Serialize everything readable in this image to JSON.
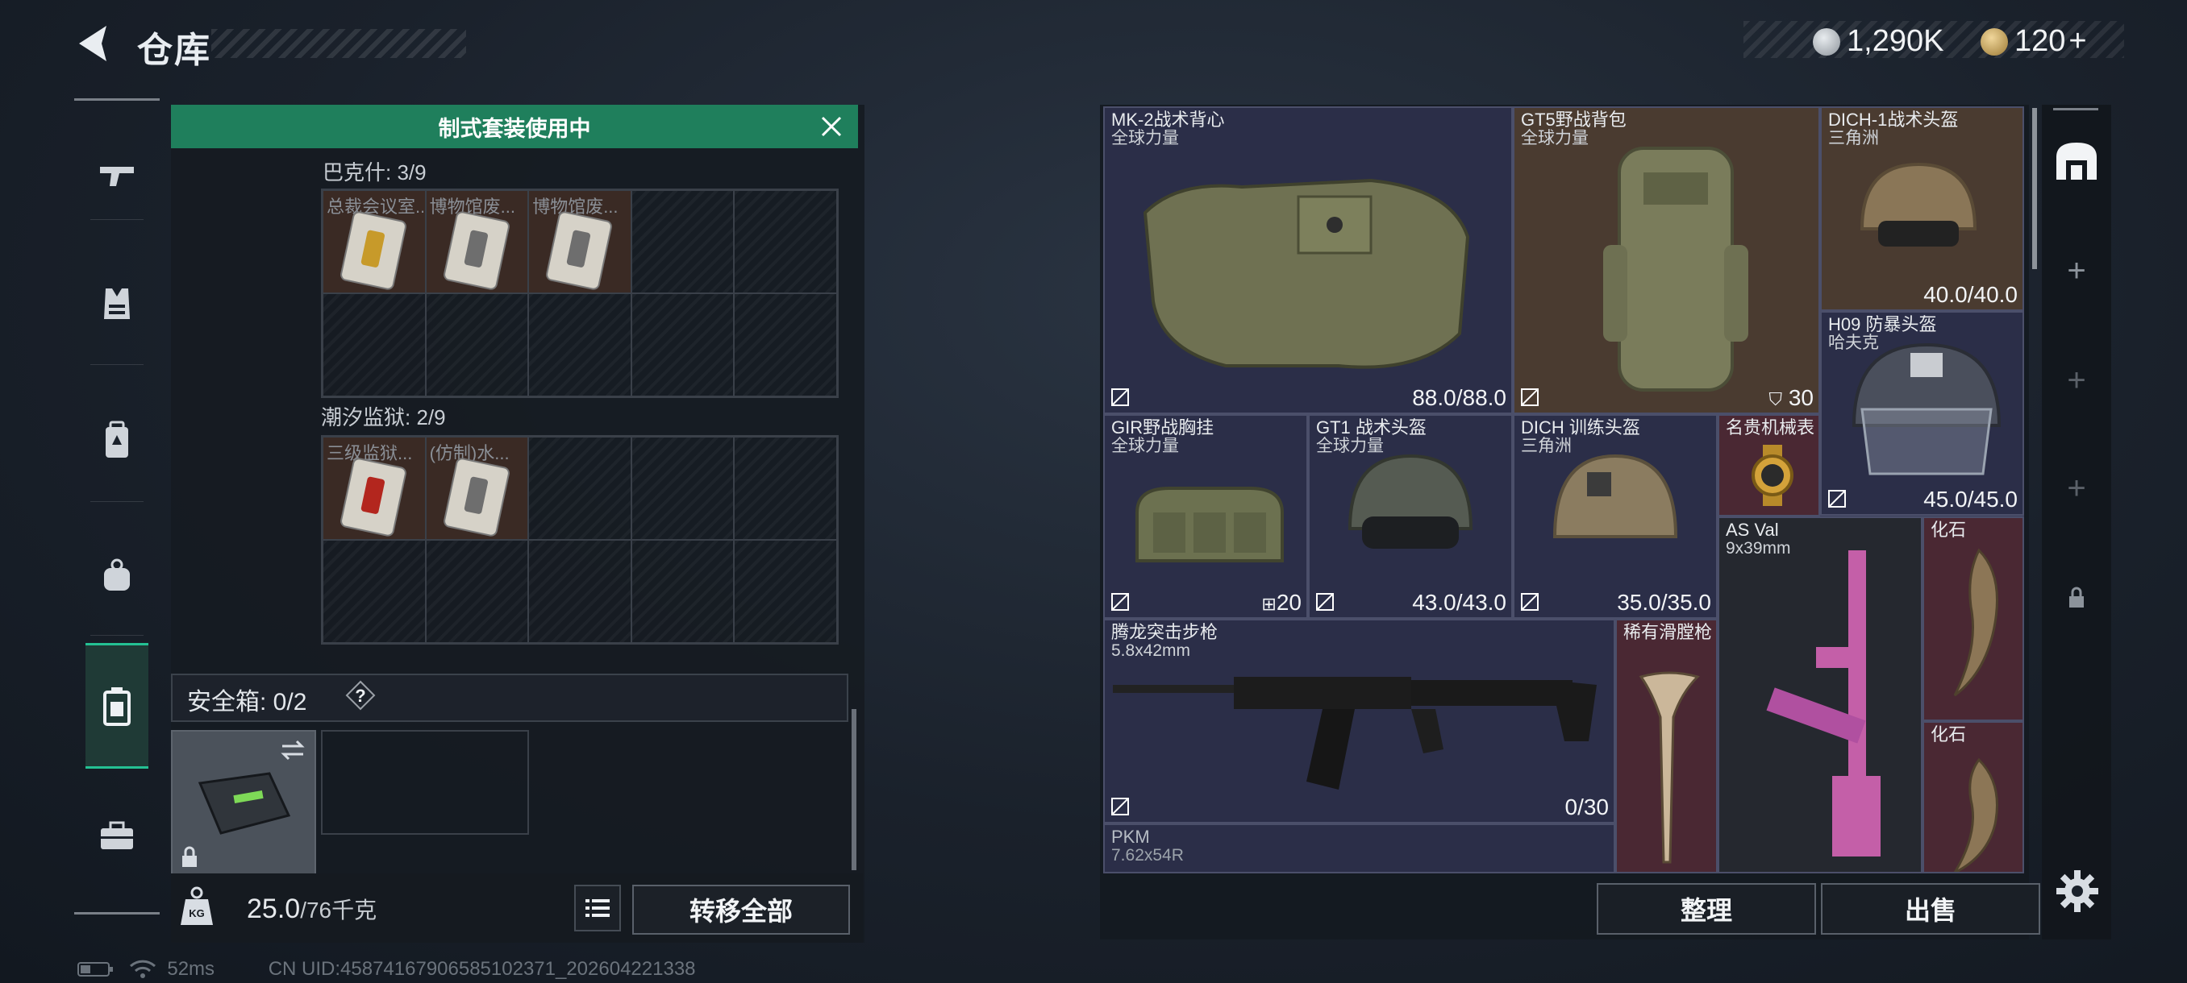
{
  "header": {
    "title": "仓库"
  },
  "currency": [
    {
      "name": "silver-coin",
      "value": "1,290K",
      "color": "#b9c0c8"
    },
    {
      "name": "gold-coin",
      "value": "120",
      "color": "#c8a35a"
    }
  ],
  "sidebar": {
    "active_index": 4,
    "icons": [
      "gun-icon",
      "vest-icon",
      "backpack-icon",
      "bag-icon",
      "container-icon",
      "toolbox-icon"
    ]
  },
  "left_panel": {
    "banner": "制式套装使用中",
    "section1": {
      "label": "巴克什: 3/9",
      "items": [
        "总裁会议室...",
        "博物馆废...",
        "博物馆废..."
      ]
    },
    "section2": {
      "label": "潮汐监狱: 2/9",
      "items": [
        "三级监狱...",
        "(仿制)水..."
      ]
    },
    "safe_box": {
      "label": "安全箱: 0/2",
      "help": "?"
    },
    "weight": {
      "current": "25.0",
      "max": "/76千克"
    },
    "transfer_label": "转移全部"
  },
  "inventory": {
    "items": [
      {
        "name": "MK-2战术背心",
        "sub": "全球力量",
        "value": "88.0/88.0"
      },
      {
        "name": "GT5野战背包",
        "sub": "全球力量",
        "value": "30"
      },
      {
        "name": "DICH-1战术头盔",
        "sub": "三角洲",
        "value": "40.0/40.0"
      },
      {
        "name": "H09 防暴头盔",
        "sub": "哈夫克",
        "value": "45.0/45.0"
      },
      {
        "name": "GIR野战胸挂",
        "sub": "全球力量",
        "value": "20"
      },
      {
        "name": "GT1 战术头盔",
        "sub": "全球力量",
        "value": "43.0/43.0"
      },
      {
        "name": "DICH 训练头盔",
        "sub": "三角洲",
        "value": "35.0/35.0"
      },
      {
        "name": "名贵机械表",
        "sub": "",
        "value": ""
      },
      {
        "name": "AS Val",
        "sub": "9x39mm",
        "value": ""
      },
      {
        "name": "化石",
        "sub": "",
        "value": ""
      },
      {
        "name": "腾龙突击步枪",
        "sub": "5.8x42mm",
        "value": "0/30"
      },
      {
        "name": "稀有滑膛枪",
        "sub": "",
        "value": ""
      },
      {
        "name": "化石",
        "sub": "",
        "value": ""
      },
      {
        "name": "PKM",
        "sub": "7.62x54R",
        "value": ""
      }
    ]
  },
  "buttons": {
    "sort": "整理",
    "sell": "出售"
  },
  "status": {
    "ping": "52ms",
    "uid": "CN UID:4587416790658510237​1_202604221338"
  }
}
